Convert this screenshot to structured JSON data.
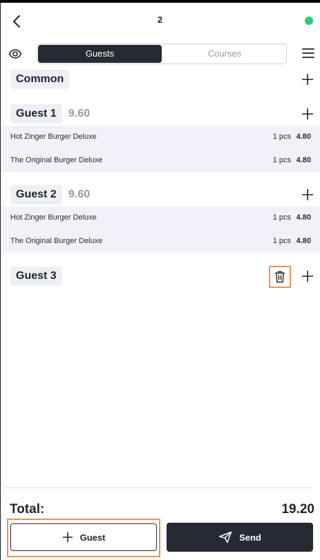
{
  "header": {
    "title": "2",
    "status_color": "#2ecc71"
  },
  "tabs": {
    "active": "Guests",
    "inactive": "Courses"
  },
  "groups": {
    "common": {
      "label": "Common"
    },
    "guest1": {
      "label": "Guest 1",
      "total": "9.60",
      "items": [
        {
          "name": "Hot Zinger Burger Deluxe",
          "qty": "1 pcs",
          "price": "4.80"
        },
        {
          "name": "The Original Burger Deluxe",
          "qty": "1 pcs",
          "price": "4.80"
        }
      ]
    },
    "guest2": {
      "label": "Guest 2",
      "total": "9.60",
      "items": [
        {
          "name": "Hot Zinger Burger Deluxe",
          "qty": "1 pcs",
          "price": "4.80"
        },
        {
          "name": "The Original Burger Deluxe",
          "qty": "1 pcs",
          "price": "4.80"
        }
      ]
    },
    "guest3": {
      "label": "Guest 3"
    }
  },
  "footer": {
    "total_label": "Total:",
    "total_value": "19.20",
    "guest_button": "Guest",
    "send_button": "Send"
  },
  "icons": [
    "back-icon",
    "eye-icon",
    "menu-icon",
    "plus-icon",
    "trash-icon",
    "send-icon"
  ],
  "colors": {
    "dark": "#262a33",
    "highlight": "#e8935a",
    "item_bg": "#f1f2f9"
  }
}
